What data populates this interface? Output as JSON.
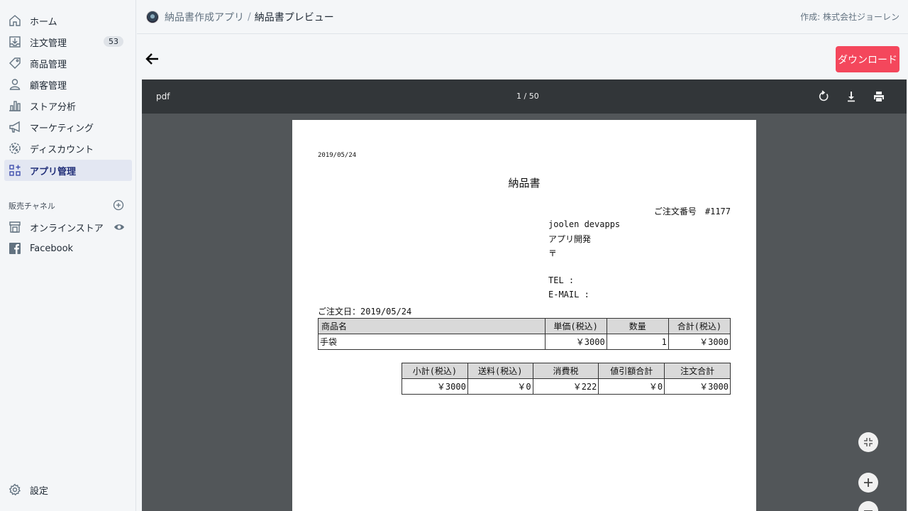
{
  "sidebar": {
    "items": [
      {
        "label": "ホーム",
        "icon": "home-icon"
      },
      {
        "label": "注文管理",
        "icon": "orders-icon",
        "badge": "53"
      },
      {
        "label": "商品管理",
        "icon": "tag-icon"
      },
      {
        "label": "顧客管理",
        "icon": "person-icon"
      },
      {
        "label": "ストア分析",
        "icon": "analytics-icon"
      },
      {
        "label": "マーケティング",
        "icon": "megaphone-icon"
      },
      {
        "label": "ディスカウント",
        "icon": "discount-icon"
      },
      {
        "label": "アプリ管理",
        "icon": "apps-icon",
        "active": true
      }
    ],
    "channels_title": "販売チャネル",
    "channels": [
      {
        "label": "オンラインストア",
        "icon": "store-icon"
      },
      {
        "label": "Facebook",
        "icon": "facebook-icon"
      }
    ],
    "settings_label": "設定"
  },
  "header": {
    "app_name": "納品書作成アプリ",
    "separator": "/",
    "page_name": "納品書プレビュー",
    "author": "作成: 株式会社ジョーレン"
  },
  "actions": {
    "download_label": "ダウンロード"
  },
  "viewer": {
    "title": "pdf",
    "page_indicator": "1 / 50"
  },
  "document": {
    "date": "2019/05/24",
    "title": "納品書",
    "order_number": "ご注文番号　#1177",
    "address_lines": [
      "joolen devapps",
      "アプリ開発",
      "〒",
      "",
      "TEL :",
      "E-MAIL :"
    ],
    "order_date": "ご注文日：2019/05/24",
    "items_table": {
      "headers": [
        "商品名",
        "単価(税込)",
        "数量",
        "合計(税込)"
      ],
      "rows": [
        [
          "手袋",
          "￥3000",
          "1",
          "￥3000"
        ]
      ]
    },
    "summary_table": {
      "headers": [
        "小計(税込)",
        "送料(税込)",
        "消費税",
        "値引額合計",
        "注文合計"
      ],
      "values": [
        "￥3000",
        "￥0",
        "￥222",
        "￥0",
        "￥3000"
      ]
    }
  },
  "colors": {
    "accent": "#f4475c",
    "active_nav": "#e3e7f2",
    "viewer_bg": "#525659",
    "viewer_toolbar": "#323639"
  }
}
